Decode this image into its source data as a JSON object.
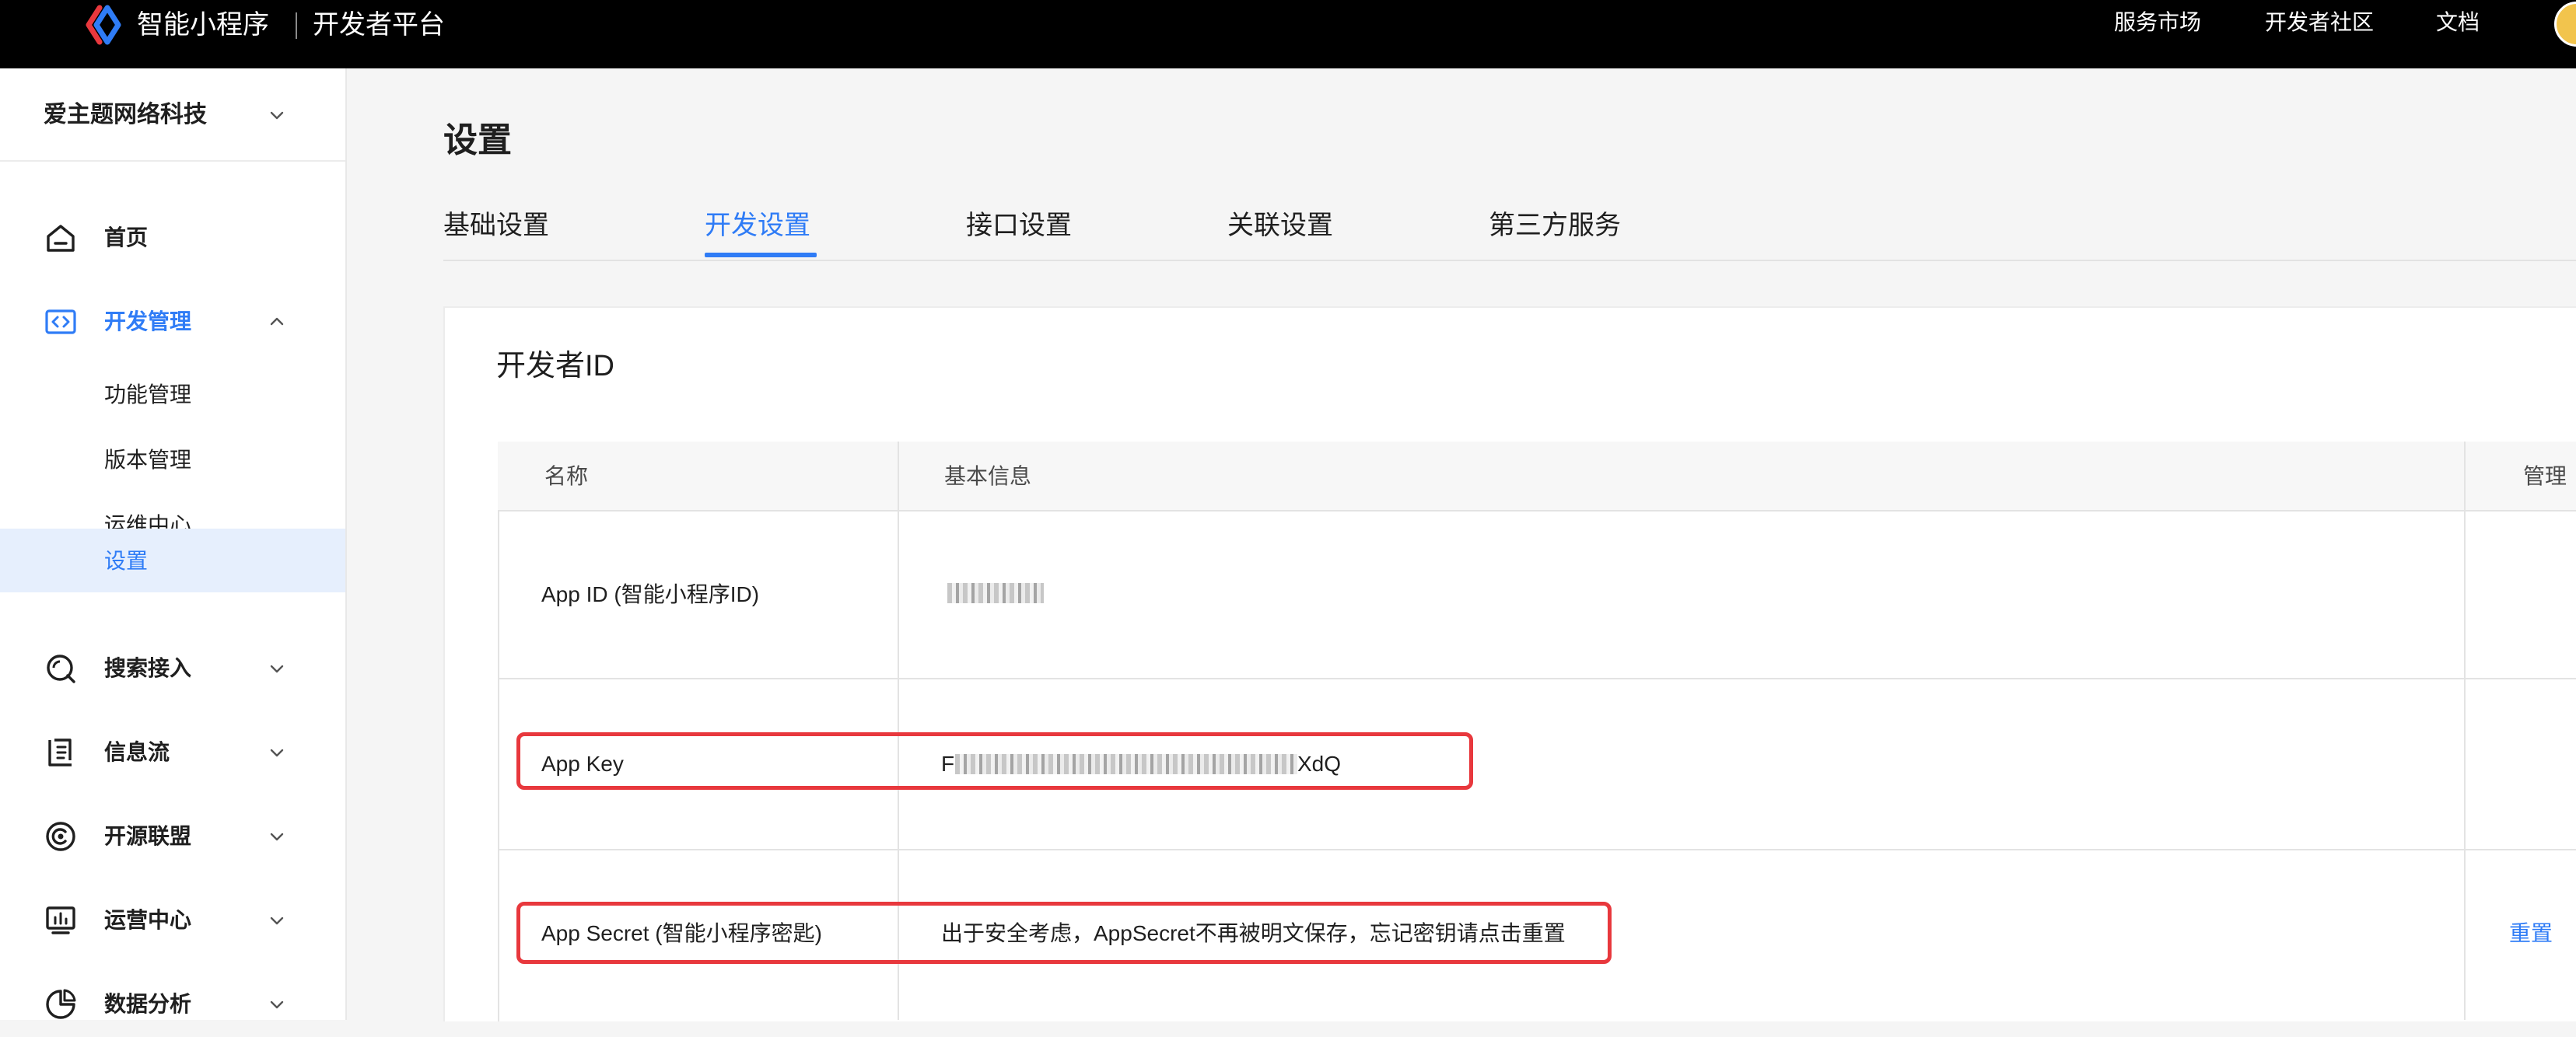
{
  "topbar": {
    "logo_text": "智能小程序",
    "logo_sub": "开发者平台",
    "nav": [
      {
        "label": "服务市场"
      },
      {
        "label": "开发者社区"
      },
      {
        "label": "文档"
      }
    ]
  },
  "sidebar": {
    "org_name": "爱主题网络科技",
    "items": [
      {
        "label": "首页",
        "icon": "home-icon"
      },
      {
        "label": "开发管理",
        "icon": "code-icon",
        "active": true
      },
      {
        "label": "搜索接入",
        "icon": "search-icon"
      },
      {
        "label": "信息流",
        "icon": "feed-icon"
      },
      {
        "label": "开源联盟",
        "icon": "alliance-icon"
      },
      {
        "label": "运营中心",
        "icon": "monitor-icon"
      },
      {
        "label": "数据分析",
        "icon": "pie-chart-icon"
      }
    ],
    "sub_items": [
      {
        "label": "功能管理"
      },
      {
        "label": "版本管理"
      },
      {
        "label": "运维中心"
      },
      {
        "label": "设置",
        "selected": true
      }
    ]
  },
  "main": {
    "title": "设置",
    "tabs": [
      {
        "label": "基础设置"
      },
      {
        "label": "开发设置",
        "active": true
      },
      {
        "label": "接口设置"
      },
      {
        "label": "关联设置"
      },
      {
        "label": "第三方服务"
      }
    ],
    "section_title": "开发者ID",
    "table": {
      "headers": [
        "名称",
        "基本信息",
        "管理"
      ],
      "rows": [
        {
          "name": "App ID (智能小程序ID)",
          "info_prefix": "",
          "info_suffix": ""
        },
        {
          "name": "App Key",
          "info_prefix": "F",
          "info_suffix": "XdQ"
        },
        {
          "name": "App Secret (智能小程序密匙)",
          "info_text": "出于安全考虑，AppSecret不再被明文保存，忘记密钥请点击重置",
          "action": "重置"
        }
      ]
    }
  },
  "colors": {
    "accent": "#2f7cf6",
    "highlight_box": "#e8383d",
    "topbar": "#000000"
  }
}
